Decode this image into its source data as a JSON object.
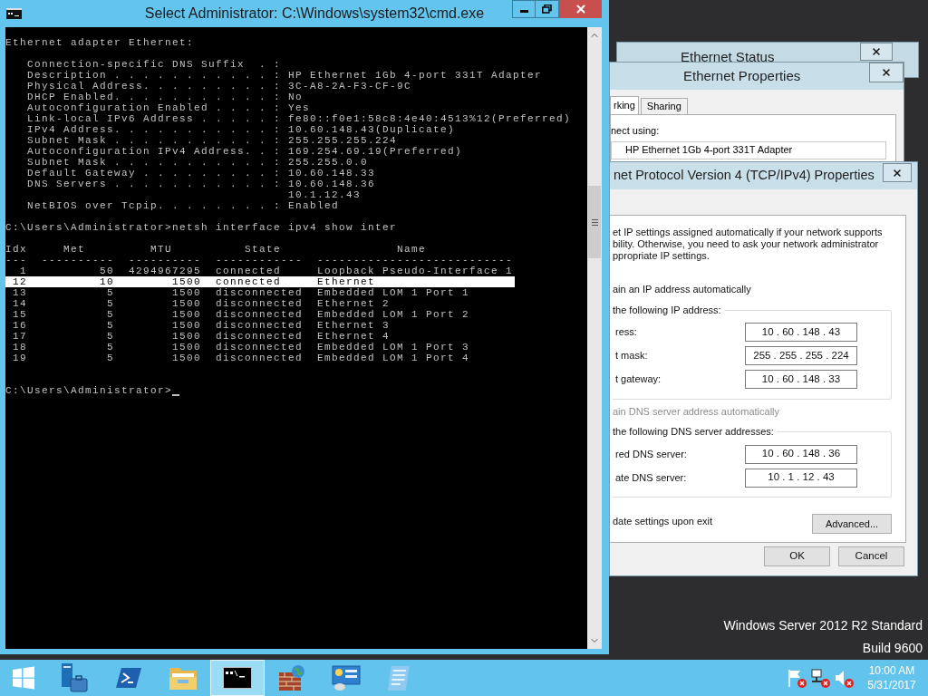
{
  "console_window": {
    "title": "Select Administrator: C:\\Windows\\system32\\cmd.exe",
    "lines": [
      {
        "kind": "text",
        "text": "Ethernet adapter Ethernet:"
      },
      {
        "kind": "blank"
      },
      {
        "kind": "text",
        "text": "   Connection-specific DNS Suffix  . :"
      },
      {
        "kind": "text",
        "text": "   Description . . . . . . . . . . . : HP Ethernet 1Gb 4-port 331T Adapter"
      },
      {
        "kind": "text",
        "text": "   Physical Address. . . . . . . . . : 3C-A8-2A-F3-CF-9C"
      },
      {
        "kind": "text",
        "text": "   DHCP Enabled. . . . . . . . . . . : No"
      },
      {
        "kind": "text",
        "text": "   Autoconfiguration Enabled . . . . : Yes"
      },
      {
        "kind": "text",
        "text": "   Link-local IPv6 Address . . . . . : fe80::f0e1:58c8:4e40:4513%12(Preferred)"
      },
      {
        "kind": "text",
        "text": "   IPv4 Address. . . . . . . . . . . : 10.60.148.43(Duplicate)"
      },
      {
        "kind": "text",
        "text": "   Subnet Mask . . . . . . . . . . . : 255.255.255.224"
      },
      {
        "kind": "text",
        "text": "   Autoconfiguration IPv4 Address. . : 169.254.69.19(Preferred)"
      },
      {
        "kind": "text",
        "text": "   Subnet Mask . . . . . . . . . . . : 255.255.0.0"
      },
      {
        "kind": "text",
        "text": "   Default Gateway . . . . . . . . . : 10.60.148.33"
      },
      {
        "kind": "text",
        "text": "   DNS Servers . . . . . . . . . . . : 10.60.148.36"
      },
      {
        "kind": "text",
        "text": "                                       10.1.12.43"
      },
      {
        "kind": "text",
        "text": "   NetBIOS over Tcpip. . . . . . . . : Enabled"
      },
      {
        "kind": "blank"
      },
      {
        "kind": "text",
        "text": "C:\\Users\\Administrator>netsh interface ipv4 show inter"
      },
      {
        "kind": "blank"
      }
    ],
    "table": {
      "header": "Idx     Met         MTU          State                Name",
      "rule": "---  ----------  ----------  ------------  ---------------------------",
      "rows": [
        {
          "text": "  1          50  4294967295  connected     Loopback Pseudo-Interface 1",
          "selected": false
        },
        {
          "text": " 12          10        1500  connected     Ethernet",
          "selected": true
        },
        {
          "text": " 13           5        1500  disconnected  Embedded LOM 1 Port 1",
          "selected": false
        },
        {
          "text": " 14           5        1500  disconnected  Ethernet 2",
          "selected": false
        },
        {
          "text": " 15           5        1500  disconnected  Embedded LOM 1 Port 2",
          "selected": false
        },
        {
          "text": " 16           5        1500  disconnected  Ethernet 3",
          "selected": false
        },
        {
          "text": " 17           5        1500  disconnected  Ethernet 4",
          "selected": false
        },
        {
          "text": " 18           5        1500  disconnected  Embedded LOM 1 Port 3",
          "selected": false
        },
        {
          "text": " 19           5        1500  disconnected  Embedded LOM 1 Port 4",
          "selected": false
        }
      ]
    },
    "prompt": "C:\\Users\\Administrator>"
  },
  "status_dialog": {
    "title": "Ethernet Status"
  },
  "properties_dialog": {
    "title": "Ethernet Properties",
    "tabs": [
      {
        "label": "rking",
        "selected": true
      },
      {
        "label": "Sharing",
        "selected": false
      }
    ],
    "connect_label": "nect using:",
    "adapter": "HP Ethernet 1Gb 4-port 331T Adapter"
  },
  "ipv4_dialog": {
    "title": "net Protocol Version 4 (TCP/IPv4) Properties",
    "intro_lines": [
      "et IP settings assigned automatically if your network supports",
      "bility. Otherwise, you need to ask your network administrator",
      "ppropriate IP settings."
    ],
    "auto_ip_option": {
      "label": "ain an IP address automatically",
      "disabled": false
    },
    "ip_group": {
      "legend": "the following IP address:",
      "fields": [
        {
          "label": "ress:",
          "value": "10 . 60 . 148 . 43"
        },
        {
          "label": "t mask:",
          "value": "255 . 255 . 255 . 224"
        },
        {
          "label": "t gateway:",
          "value": "10 . 60 . 148 . 33"
        }
      ]
    },
    "auto_dns_option": {
      "label": "ain DNS server address automatically",
      "disabled": true
    },
    "dns_group": {
      "legend": "the following DNS server addresses:",
      "fields": [
        {
          "label": "red DNS server:",
          "value": "10 . 60 . 148 . 36"
        },
        {
          "label": "ate DNS server:",
          "value": "10 . 1 . 12 . 43"
        }
      ]
    },
    "validate_option": "date settings upon exit",
    "advanced_button": "Advanced...",
    "buttons": [
      "OK",
      "Cancel"
    ]
  },
  "desktop": {
    "edition": "Windows Server 2012 R2 Standard",
    "build": "Build 9600"
  },
  "taskbar": {
    "apps": [
      {
        "kind": "start",
        "selected": false
      },
      {
        "kind": "server",
        "selected": false
      },
      {
        "kind": "shell",
        "selected": false
      },
      {
        "kind": "folder",
        "selected": false
      },
      {
        "kind": "console",
        "selected": true
      },
      {
        "kind": "firewall",
        "selected": false
      },
      {
        "kind": "panel",
        "selected": false
      },
      {
        "kind": "notepad",
        "selected": false
      }
    ],
    "tray": [
      {
        "kind": "flag"
      },
      {
        "kind": "network"
      },
      {
        "kind": "speaker"
      }
    ],
    "clock": {
      "time": "10:00 AM",
      "date": "5/31/2017"
    }
  }
}
